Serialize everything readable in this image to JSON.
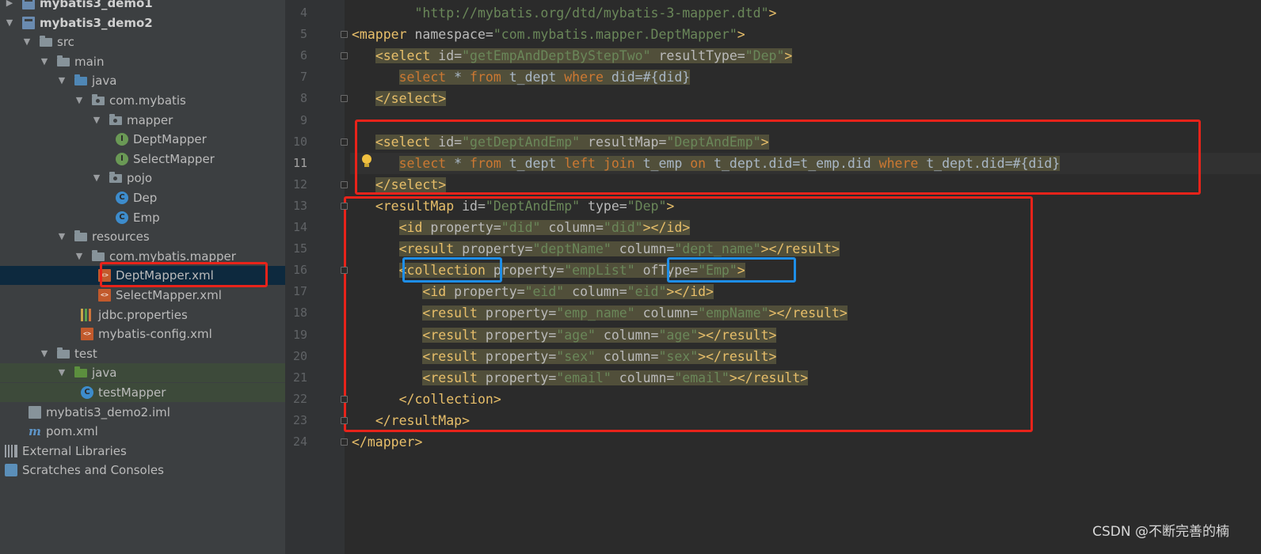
{
  "project_tree": [
    {
      "label": "mybatis3_demo1",
      "icon": "module-icon",
      "arrow": "▶",
      "indent": 0,
      "bold": true
    },
    {
      "label": "mybatis3_demo2",
      "icon": "module-icon",
      "arrow": "▼",
      "indent": 0,
      "bold": true
    },
    {
      "label": "src",
      "icon": "folder-icon",
      "arrow": "▼",
      "indent": 1
    },
    {
      "label": "main",
      "icon": "folder-icon",
      "arrow": "▼",
      "indent": 2
    },
    {
      "label": "java",
      "icon": "source-folder-icon",
      "arrow": "▼",
      "indent": 3
    },
    {
      "label": "com.mybatis",
      "icon": "package-icon",
      "arrow": "▼",
      "indent": 4
    },
    {
      "label": "mapper",
      "icon": "package-icon",
      "arrow": "▼",
      "indent": 5
    },
    {
      "label": "DeptMapper",
      "icon": "interface-icon",
      "arrow": "",
      "indent": 6
    },
    {
      "label": "SelectMapper",
      "icon": "interface-icon",
      "arrow": "",
      "indent": 6
    },
    {
      "label": "pojo",
      "icon": "package-icon",
      "arrow": "▼",
      "indent": 5
    },
    {
      "label": "Dep",
      "icon": "class-icon",
      "arrow": "",
      "indent": 6
    },
    {
      "label": "Emp",
      "icon": "class-icon",
      "arrow": "",
      "indent": 6
    },
    {
      "label": "resources",
      "icon": "resources-folder-icon",
      "arrow": "▼",
      "indent": 3
    },
    {
      "label": "com.mybatis.mapper",
      "icon": "folder-icon",
      "arrow": "▼",
      "indent": 4
    },
    {
      "label": "DeptMapper.xml",
      "icon": "xml-file-icon",
      "arrow": "",
      "indent": 5,
      "selected": true
    },
    {
      "label": "SelectMapper.xml",
      "icon": "xml-file-icon",
      "arrow": "",
      "indent": 5
    },
    {
      "label": "jdbc.properties",
      "icon": "properties-file-icon",
      "arrow": "",
      "indent": 4
    },
    {
      "label": "mybatis-config.xml",
      "icon": "xml-file-icon",
      "arrow": "",
      "indent": 4
    },
    {
      "label": "test",
      "icon": "folder-icon",
      "arrow": "▼",
      "indent": 2
    },
    {
      "label": "java",
      "icon": "test-folder-icon",
      "arrow": "▼",
      "indent": 3,
      "highlight": true
    },
    {
      "label": "testMapper",
      "icon": "test-class-icon",
      "arrow": "",
      "indent": 4,
      "highlight": true
    },
    {
      "label": "mybatis3_demo2.iml",
      "icon": "iml-file-icon",
      "arrow": "",
      "indent": 1
    },
    {
      "label": "pom.xml",
      "icon": "maven-icon",
      "arrow": "",
      "indent": 1
    },
    {
      "label": "External Libraries",
      "icon": "libraries-icon",
      "arrow": "",
      "indent": 0
    },
    {
      "label": "Scratches and Consoles",
      "icon": "scratches-icon",
      "arrow": "",
      "indent": 0
    }
  ],
  "icon_glyphs": {
    "interface-icon": "I",
    "class-icon": "C",
    "test-class-icon": "C",
    "xml-file-icon": "<>",
    "maven-icon": "m"
  },
  "editor": {
    "current_line": 11,
    "lines": [
      {
        "n": 4,
        "indent": "        ",
        "tokens": [
          [
            "val",
            "\"http://mybatis.org/dtd/mybatis-3-mapper.dtd\""
          ],
          [
            "tag",
            ">"
          ]
        ]
      },
      {
        "n": 5,
        "indent": "",
        "tokens": [
          [
            "tag",
            "<mapper "
          ],
          [
            "attr",
            "namespace="
          ],
          [
            "val",
            "\"com.mybatis.mapper.DeptMapper\""
          ],
          [
            "tag",
            ">"
          ]
        ]
      },
      {
        "n": 6,
        "indent": "   ",
        "tokens": [
          [
            "tag",
            "<select "
          ],
          [
            "attr",
            "id="
          ],
          [
            "val",
            "\"getEmpAndDeptByStepTwo\""
          ],
          [
            "attr",
            " resultType="
          ],
          [
            "val",
            "\"Dep\""
          ],
          [
            "tag",
            ">"
          ]
        ],
        "hl": true
      },
      {
        "n": 7,
        "indent": "      ",
        "tokens": [
          [
            "sql",
            "select "
          ],
          [
            "plain",
            "* "
          ],
          [
            "sql",
            "from "
          ],
          [
            "plain",
            "t_dept "
          ],
          [
            "sql",
            "where "
          ],
          [
            "plain",
            "did=#{did}"
          ]
        ],
        "hl": true
      },
      {
        "n": 8,
        "indent": "   ",
        "tokens": [
          [
            "tag",
            "</select>"
          ]
        ],
        "hl": true
      },
      {
        "n": 9,
        "indent": "",
        "tokens": []
      },
      {
        "n": 10,
        "indent": "   ",
        "tokens": [
          [
            "tag",
            "<select "
          ],
          [
            "attr",
            "id="
          ],
          [
            "val",
            "\"getDeptAndEmp\""
          ],
          [
            "attr",
            " resultMap="
          ],
          [
            "val",
            "\"DeptAndEmp\""
          ],
          [
            "tag",
            ">"
          ]
        ],
        "hl": true
      },
      {
        "n": 11,
        "indent": "      ",
        "tokens": [
          [
            "sql",
            "select "
          ],
          [
            "plain",
            "* "
          ],
          [
            "sql",
            "from "
          ],
          [
            "plain",
            "t_dept "
          ],
          [
            "sql",
            "left join "
          ],
          [
            "plain",
            "t_emp "
          ],
          [
            "sql",
            "on "
          ],
          [
            "plain",
            "t_dept.did=t_emp.did "
          ],
          [
            "sql",
            "where "
          ],
          [
            "plain",
            "t_dept.did=#{did}"
          ]
        ],
        "hl": true
      },
      {
        "n": 12,
        "indent": "   ",
        "tokens": [
          [
            "tag",
            "</select>"
          ]
        ],
        "hl": true
      },
      {
        "n": 13,
        "indent": "   ",
        "tokens": [
          [
            "tag",
            "<resultMap "
          ],
          [
            "attr",
            "id="
          ],
          [
            "val",
            "\"DeptAndEmp\""
          ],
          [
            "attr",
            " type="
          ],
          [
            "val",
            "\"Dep\""
          ],
          [
            "tag",
            ">"
          ]
        ]
      },
      {
        "n": 14,
        "indent": "      ",
        "tokens": [
          [
            "tag",
            "<id "
          ],
          [
            "attr",
            "property="
          ],
          [
            "val",
            "\"did\""
          ],
          [
            "attr",
            " column="
          ],
          [
            "val",
            "\"did\""
          ],
          [
            "tag",
            "></id>"
          ]
        ],
        "hl": true
      },
      {
        "n": 15,
        "indent": "      ",
        "tokens": [
          [
            "tag",
            "<result "
          ],
          [
            "attr",
            "property="
          ],
          [
            "val",
            "\"deptName\""
          ],
          [
            "attr",
            " column="
          ],
          [
            "val",
            "\"dept_name\""
          ],
          [
            "tag",
            "></result>"
          ]
        ],
        "hl": true
      },
      {
        "n": 16,
        "indent": "      ",
        "tokens": [
          [
            "tag",
            "<collection "
          ],
          [
            "attr",
            "property="
          ],
          [
            "val",
            "\"empList\""
          ],
          [
            "attr",
            " ofType="
          ],
          [
            "val",
            "\"Emp\""
          ],
          [
            "tag",
            ">"
          ]
        ],
        "hl": true
      },
      {
        "n": 17,
        "indent": "         ",
        "tokens": [
          [
            "tag",
            "<id "
          ],
          [
            "attr",
            "property="
          ],
          [
            "val",
            "\"eid\""
          ],
          [
            "attr",
            " column="
          ],
          [
            "val",
            "\"eid\""
          ],
          [
            "tag",
            "></id>"
          ]
        ],
        "hl": true
      },
      {
        "n": 18,
        "indent": "         ",
        "tokens": [
          [
            "tag",
            "<result "
          ],
          [
            "attr",
            "property="
          ],
          [
            "val",
            "\"emp_name\""
          ],
          [
            "attr",
            " column="
          ],
          [
            "val",
            "\"empName\""
          ],
          [
            "tag",
            "></result>"
          ]
        ],
        "hl": true
      },
      {
        "n": 19,
        "indent": "         ",
        "tokens": [
          [
            "tag",
            "<result "
          ],
          [
            "attr",
            "property="
          ],
          [
            "val",
            "\"age\""
          ],
          [
            "attr",
            " column="
          ],
          [
            "val",
            "\"age\""
          ],
          [
            "tag",
            "></result>"
          ]
        ],
        "hl": true
      },
      {
        "n": 20,
        "indent": "         ",
        "tokens": [
          [
            "tag",
            "<result "
          ],
          [
            "attr",
            "property="
          ],
          [
            "val",
            "\"sex\""
          ],
          [
            "attr",
            " column="
          ],
          [
            "val",
            "\"sex\""
          ],
          [
            "tag",
            "></result>"
          ]
        ],
        "hl": true
      },
      {
        "n": 21,
        "indent": "         ",
        "tokens": [
          [
            "tag",
            "<result "
          ],
          [
            "attr",
            "property="
          ],
          [
            "val",
            "\"email\""
          ],
          [
            "attr",
            " column="
          ],
          [
            "val",
            "\"email\""
          ],
          [
            "tag",
            "></result>"
          ]
        ],
        "hl": true
      },
      {
        "n": 22,
        "indent": "      ",
        "tokens": [
          [
            "tag",
            "</collection>"
          ]
        ]
      },
      {
        "n": 23,
        "indent": "   ",
        "tokens": [
          [
            "tag",
            "</resultMap>"
          ]
        ]
      },
      {
        "n": 24,
        "indent": "",
        "tokens": [
          [
            "tag",
            "</mapper>"
          ]
        ]
      }
    ]
  },
  "watermark": "CSDN @不断完善的楠",
  "colors": {
    "annotation_red": "#e8231a",
    "annotation_blue": "#1e8ee8",
    "selection": "#0d293e",
    "line_highlight": "#514f3a"
  }
}
